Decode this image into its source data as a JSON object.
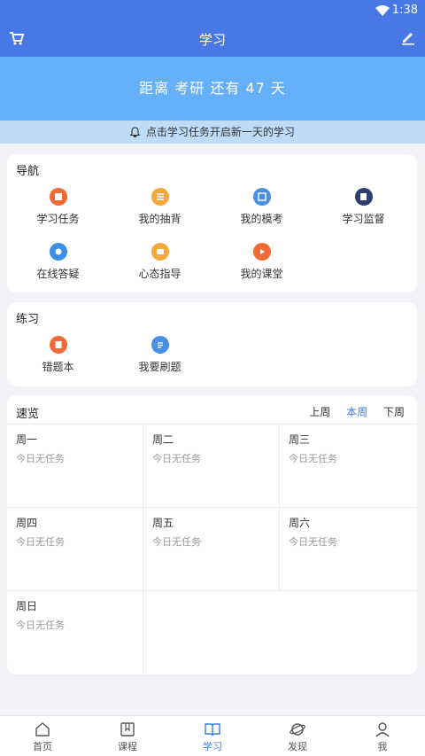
{
  "statusbar": {
    "time": "1:38"
  },
  "appbar": {
    "title": "学习"
  },
  "banner": {
    "text": "距离 考研 还有 47 天"
  },
  "tip": {
    "text": "点击学习任务开启新一天的学习"
  },
  "nav": {
    "title": "导航",
    "items": [
      {
        "label": "学习任务",
        "color": "#f06a35"
      },
      {
        "label": "我的抽背",
        "color": "#f5a93a"
      },
      {
        "label": "我的模考",
        "color": "#4a90e2"
      },
      {
        "label": "学习监督",
        "color": "#2f3e6e"
      },
      {
        "label": "在线答疑",
        "color": "#3a8fe8"
      },
      {
        "label": "心态指导",
        "color": "#f5a93a"
      },
      {
        "label": "我的课堂",
        "color": "#f06a35"
      }
    ]
  },
  "practice": {
    "title": "练习",
    "items": [
      {
        "label": "错题本",
        "color": "#f06a35"
      },
      {
        "label": "我要刷题",
        "color": "#4a90e2"
      }
    ]
  },
  "overview": {
    "title": "速览",
    "weeks": {
      "prev": "上周",
      "current": "本周",
      "next": "下周"
    },
    "days": [
      {
        "day": "周一",
        "status": "今日无任务"
      },
      {
        "day": "周二",
        "status": "今日无任务"
      },
      {
        "day": "周三",
        "status": "今日无任务"
      },
      {
        "day": "周四",
        "status": "今日无任务"
      },
      {
        "day": "周五",
        "status": "今日无任务"
      },
      {
        "day": "周六",
        "status": "今日无任务"
      },
      {
        "day": "周日",
        "status": "今日无任务"
      }
    ]
  },
  "tabs": [
    {
      "label": "首页",
      "icon": "home-icon"
    },
    {
      "label": "课程",
      "icon": "course-icon"
    },
    {
      "label": "学习",
      "icon": "study-icon"
    },
    {
      "label": "发现",
      "icon": "discover-icon"
    },
    {
      "label": "我",
      "icon": "profile-icon"
    }
  ],
  "colors": {
    "primary": "#4778e6",
    "banner": "#64b0fb",
    "accent": "#3b7bf0"
  }
}
